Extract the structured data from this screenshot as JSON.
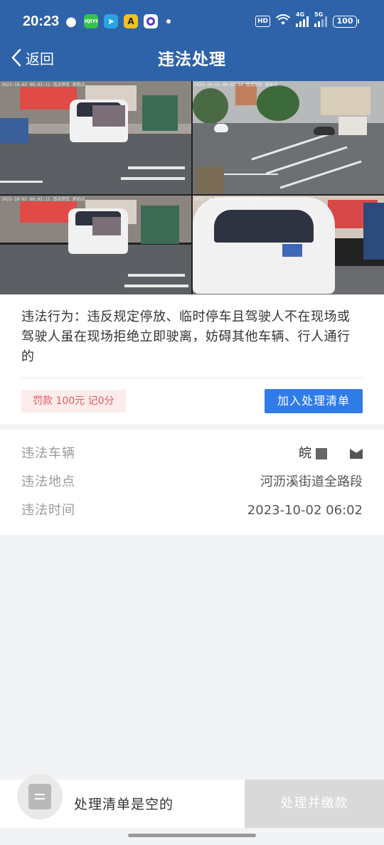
{
  "status_bar": {
    "time": "20:23",
    "apps": [
      "wechat-icon",
      "iqiyi-icon",
      "telegram-icon",
      "yellow-app-icon",
      "purple-app-icon"
    ],
    "iqiyi_label": "iQIYI",
    "hd": "HD",
    "sig1": "4G",
    "sig2": "5G",
    "battery": "100"
  },
  "header": {
    "back_label": "返回",
    "title": "违法处理",
    "bg_color": "#2e63a9"
  },
  "violation": {
    "description": "违法行为：违反规定停放、临时停车且驾驶人不在现场或驾驶人虽在现场拒绝立即驶离，妨碍其他车辆、行人通行的",
    "fine": "罚款 100元 记0分",
    "add_button": "加入处理清单"
  },
  "details": {
    "vehicle_label": "违法车辆",
    "vehicle_value": "皖",
    "location_label": "违法地点",
    "location_value": "河沥溪街道全路段",
    "time_label": "违法时间",
    "time_value": "2023-10-02 06:02"
  },
  "bottom": {
    "empty_text": "处理清单是空的",
    "pay_button": "处理并缴款"
  }
}
